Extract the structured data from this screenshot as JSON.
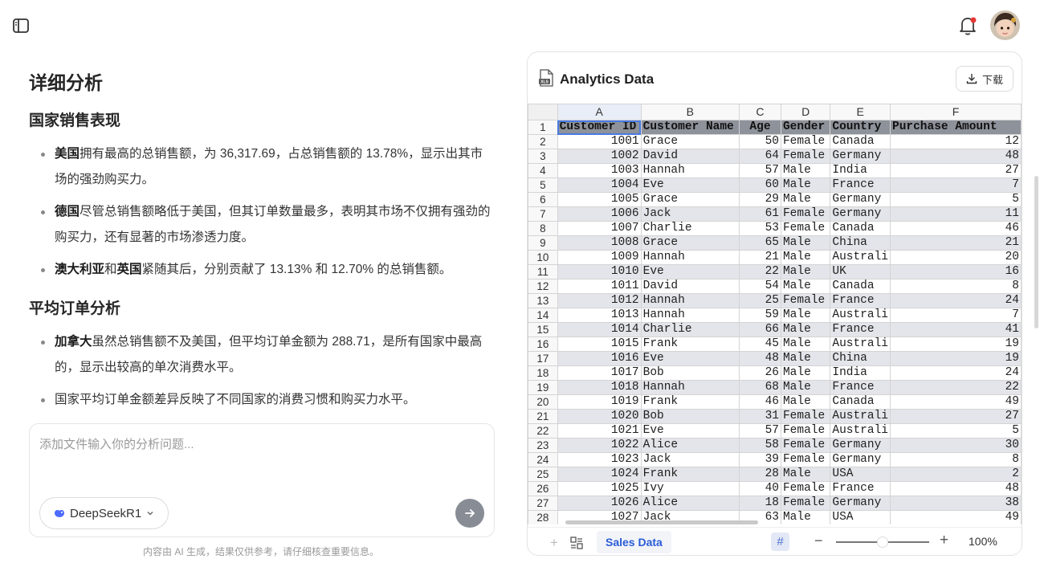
{
  "header": {
    "sidebar_toggle_icon": "sidebar-toggle-icon",
    "notification_icon": "bell-icon",
    "notification_dot_color": "#e53935",
    "avatar_icon": "user-avatar"
  },
  "chat": {
    "title": "详细分析",
    "sections": [
      {
        "heading": "国家销售表现",
        "items": [
          {
            "bold": "美国",
            "text": "拥有最高的总销售额，为 36,317.69，占总销售额的 13.78%，显示出其市场的强劲购买力。"
          },
          {
            "bold": "德国",
            "text": "尽管总销售额略低于美国，但其订单数量最多，表明其市场不仅拥有强劲的购买力，还有显著的市场渗透力度。"
          },
          {
            "bold": "澳大利亚",
            "mid": "和",
            "bold2": "英国",
            "text": "紧随其后，分别贡献了 13.13% 和 12.70% 的总销售额。"
          }
        ]
      },
      {
        "heading": "平均订单分析",
        "items": [
          {
            "bold": "加拿大",
            "text": "虽然总销售额不及美国，但平均订单金额为 288.71，是所有国家中最高的，显示出较高的单次消费水平。"
          },
          {
            "bold": "",
            "text": "国家平均订单金额差异反映了不同国家的消费习惯和购买力水平。"
          }
        ]
      }
    ],
    "input_placeholder": "添加文件输入你的分析问题...",
    "model_label": "DeepSeekR1",
    "disclaimer": "内容由 AI 生成，结果仅供参考，请仔细核查重要信息。"
  },
  "panel": {
    "title": "Analytics Data",
    "download_label": "下载",
    "columns": [
      "A",
      "B",
      "C",
      "D",
      "E",
      "F"
    ],
    "header_row": [
      "Customer ID",
      "Customer Name",
      "Age",
      "Gender",
      "Country",
      "Purchase Amount"
    ],
    "rows": [
      [
        "1001",
        "Grace",
        "50",
        "Female",
        "Canada",
        "12"
      ],
      [
        "1002",
        "David",
        "64",
        "Female",
        "Germany",
        "48"
      ],
      [
        "1003",
        "Hannah",
        "57",
        "Male",
        "India",
        "27"
      ],
      [
        "1004",
        "Eve",
        "60",
        "Male",
        "France",
        "7"
      ],
      [
        "1005",
        "Grace",
        "29",
        "Male",
        "Germany",
        "5"
      ],
      [
        "1006",
        "Jack",
        "61",
        "Female",
        "Germany",
        "11"
      ],
      [
        "1007",
        "Charlie",
        "53",
        "Female",
        "Canada",
        "46"
      ],
      [
        "1008",
        "Grace",
        "65",
        "Male",
        "China",
        "21"
      ],
      [
        "1009",
        "Hannah",
        "21",
        "Male",
        "Australi",
        "20"
      ],
      [
        "1010",
        "Eve",
        "22",
        "Male",
        "UK",
        "16"
      ],
      [
        "1011",
        "David",
        "54",
        "Male",
        "Canada",
        "8"
      ],
      [
        "1012",
        "Hannah",
        "25",
        "Female",
        "France",
        "24"
      ],
      [
        "1013",
        "Hannah",
        "59",
        "Male",
        "Australi",
        "7"
      ],
      [
        "1014",
        "Charlie",
        "66",
        "Male",
        "France",
        "41"
      ],
      [
        "1015",
        "Frank",
        "45",
        "Male",
        "Australi",
        "19"
      ],
      [
        "1016",
        "Eve",
        "48",
        "Male",
        "China",
        "19"
      ],
      [
        "1017",
        "Bob",
        "26",
        "Male",
        "India",
        "24"
      ],
      [
        "1018",
        "Hannah",
        "68",
        "Male",
        "France",
        "22"
      ],
      [
        "1019",
        "Frank",
        "46",
        "Male",
        "Canada",
        "49"
      ],
      [
        "1020",
        "Bob",
        "31",
        "Female",
        "Australi",
        "27"
      ],
      [
        "1021",
        "Eve",
        "57",
        "Female",
        "Australi",
        "5"
      ],
      [
        "1022",
        "Alice",
        "58",
        "Female",
        "Germany",
        "30"
      ],
      [
        "1023",
        "Jack",
        "39",
        "Female",
        "Germany",
        "8"
      ],
      [
        "1024",
        "Frank",
        "28",
        "Male",
        "USA",
        "2"
      ],
      [
        "1025",
        "Ivy",
        "40",
        "Female",
        "France",
        "48"
      ],
      [
        "1026",
        "Alice",
        "18",
        "Female",
        "Germany",
        "38"
      ],
      [
        "1027",
        "Jack",
        "63",
        "Male",
        "USA",
        "49"
      ]
    ],
    "sheet_tab": "Sales Data",
    "grid_icon_label": "#",
    "zoom_level": "100%",
    "zoom_fraction": 0.5
  }
}
